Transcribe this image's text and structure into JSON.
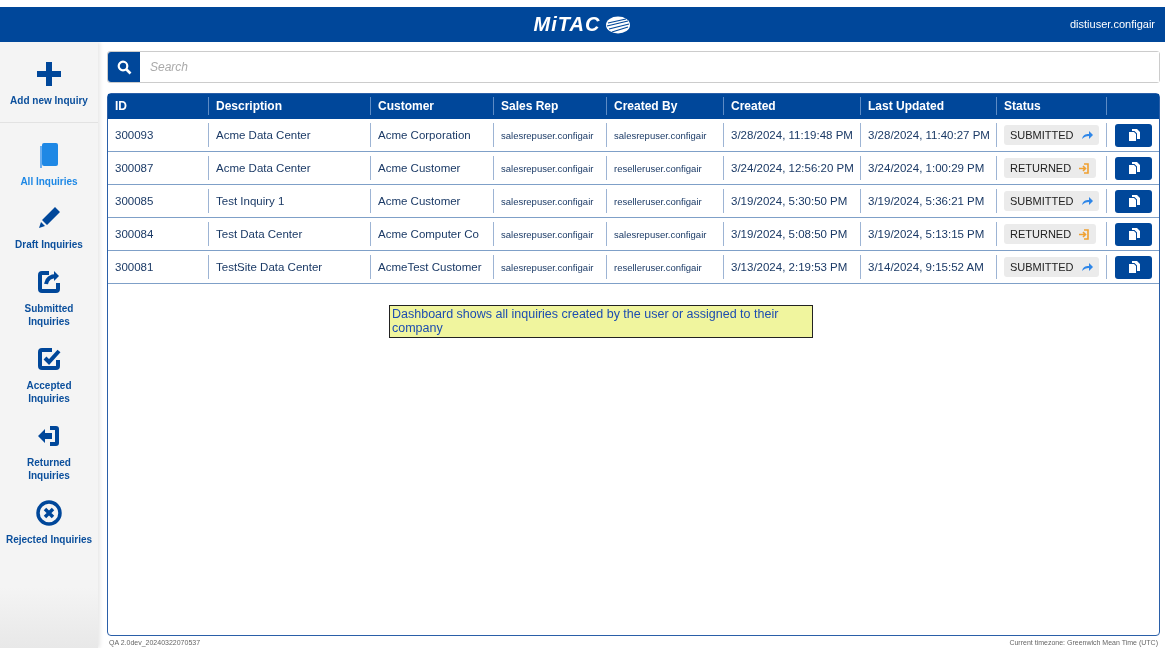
{
  "header": {
    "logo": "MiTAC",
    "user": "distiuser.configair"
  },
  "sidebar": {
    "items": [
      {
        "kind": "add",
        "label": "Add new Inquiry",
        "selected": false
      },
      {
        "kind": "all",
        "label": "All Inquiries",
        "selected": true
      },
      {
        "kind": "draft",
        "label": "Draft Inquiries",
        "selected": false
      },
      {
        "kind": "submitted",
        "label": "Submitted Inquiries",
        "selected": false
      },
      {
        "kind": "accepted",
        "label": "Accepted Inquiries",
        "selected": false
      },
      {
        "kind": "returned",
        "label": "Returned Inquiries",
        "selected": false
      },
      {
        "kind": "rejected",
        "label": "Rejected Inquiries",
        "selected": false
      }
    ]
  },
  "search": {
    "placeholder": "Search"
  },
  "table": {
    "columns": [
      "ID",
      "Description",
      "Customer",
      "Sales Rep",
      "Created By",
      "Created",
      "Last Updated",
      "Status"
    ],
    "rows": [
      {
        "id": "300093",
        "description": "Acme Data Center",
        "customer": "Acme Corporation",
        "sales_rep": "salesrepuser.configair",
        "created_by": "salesrepuser.configair",
        "created": "3/28/2024, 11:19:48 PM",
        "last_updated": "3/28/2024, 11:40:27 PM",
        "status": "SUBMITTED",
        "kind": "submitted"
      },
      {
        "id": "300087",
        "description": "Acme Data Center",
        "customer": "Acme Customer",
        "sales_rep": "salesrepuser.configair",
        "created_by": "reselleruser.configair",
        "created": "3/24/2024, 12:56:20 PM",
        "last_updated": "3/24/2024, 1:00:29 PM",
        "status": "RETURNED",
        "kind": "returned"
      },
      {
        "id": "300085",
        "description": "Test Inquiry 1",
        "customer": "Acme Customer",
        "sales_rep": "salesrepuser.configair",
        "created_by": "reselleruser.configair",
        "created": "3/19/2024, 5:30:50 PM",
        "last_updated": "3/19/2024, 5:36:21 PM",
        "status": "SUBMITTED",
        "kind": "submitted"
      },
      {
        "id": "300084",
        "description": "Test Data Center",
        "customer": "Acme Computer Co",
        "sales_rep": "salesrepuser.configair",
        "created_by": "salesrepuser.configair",
        "created": "3/19/2024, 5:08:50 PM",
        "last_updated": "3/19/2024, 5:13:15 PM",
        "status": "RETURNED",
        "kind": "returned"
      },
      {
        "id": "300081",
        "description": "TestSite Data Center",
        "customer": "AcmeTest Customer",
        "sales_rep": "salesrepuser.configair",
        "created_by": "reselleruser.configair",
        "created": "3/13/2024, 2:19:53 PM",
        "last_updated": "3/14/2024, 9:15:52 AM",
        "status": "SUBMITTED",
        "kind": "submitted"
      }
    ]
  },
  "note": "Dashboard shows all inquiries created by the user or assigned to their company",
  "footer": {
    "version": "QA 2.0dev_20240322070537",
    "timezone": "Current timezone: Greenwich Mean Time (UTC)"
  }
}
